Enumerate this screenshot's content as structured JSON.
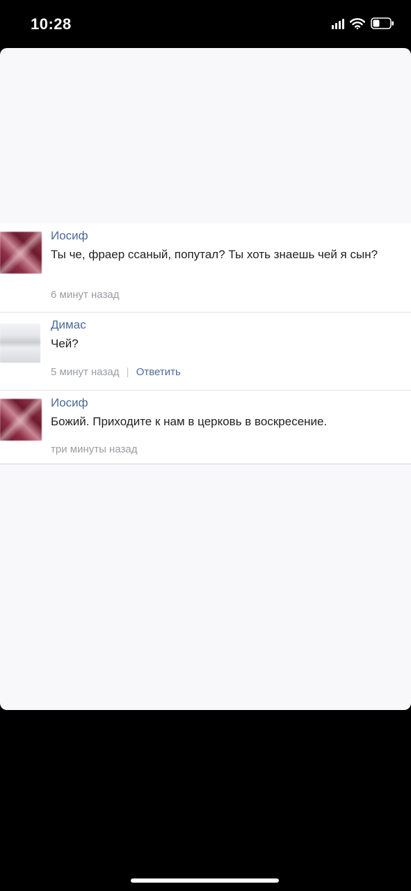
{
  "status_bar": {
    "time": "10:28",
    "icons": [
      "signal-icon",
      "wifi-icon",
      "battery-icon"
    ]
  },
  "comments": [
    {
      "author": "Иосиф",
      "text": "Ты че, фраер ссаный, попутал? Ты хоть знаешь чей я сын?",
      "time": "6 минут назад"
    },
    {
      "author": "Димас",
      "text": "Чей?",
      "time": "5 минут назад",
      "separator": "|",
      "reply": "Ответить"
    },
    {
      "author": "Иосиф",
      "text": "Божий. Приходите к нам в церковь в воскресение.",
      "time": "три минуты назад"
    }
  ],
  "colors": {
    "author": "#4a6a98",
    "text": "#1f1f1f",
    "meta": "#9a9ca3",
    "background": "#000000",
    "sheet": "#f8f8fa"
  }
}
